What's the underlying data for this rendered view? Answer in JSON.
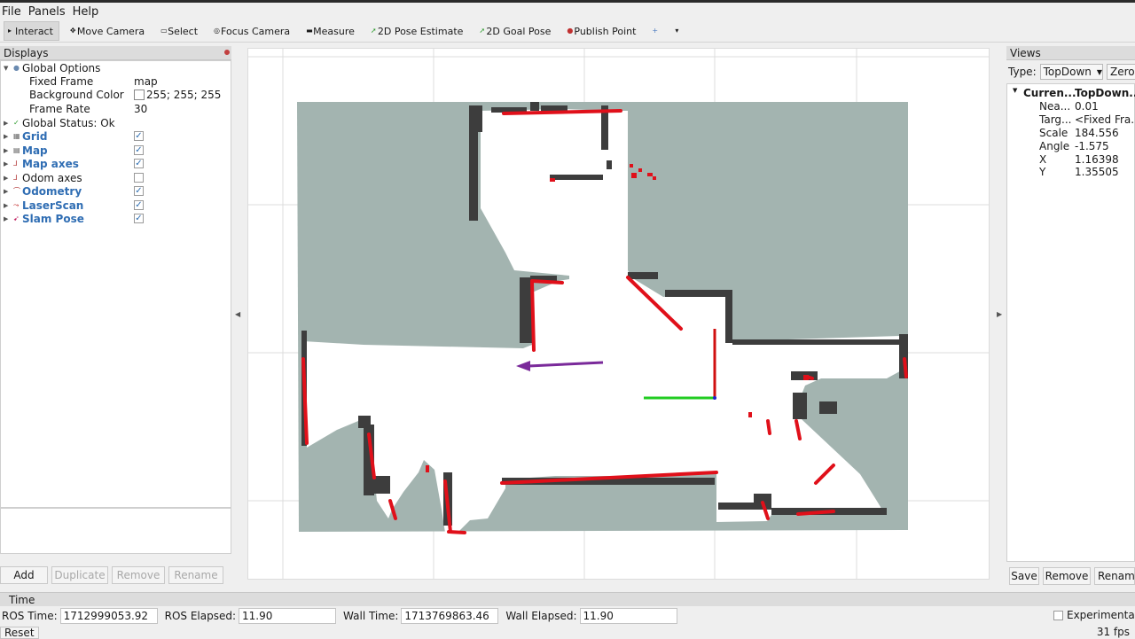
{
  "menu": [
    "File",
    "Panels",
    "Help"
  ],
  "toolbar": [
    {
      "label": "Interact",
      "icon": "cursor-icon",
      "active": true
    },
    {
      "label": "Move Camera",
      "icon": "move-icon"
    },
    {
      "label": "Select",
      "icon": "select-icon"
    },
    {
      "label": "Focus Camera",
      "icon": "focus-icon"
    },
    {
      "label": "Measure",
      "icon": "ruler-icon"
    },
    {
      "label": "2D Pose Estimate",
      "icon": "arrow-green-icon"
    },
    {
      "label": "2D Goal Pose",
      "icon": "arrow-green-icon"
    },
    {
      "label": "Publish Point",
      "icon": "pin-icon"
    }
  ],
  "displays": {
    "title": "Displays",
    "global_options": "Global Options",
    "fixed_frame_label": "Fixed Frame",
    "fixed_frame_value": "map",
    "background_label": "Background Color",
    "background_value": "255; 255; 255",
    "frame_rate_label": "Frame Rate",
    "frame_rate_value": "30",
    "global_status": "Global Status: Ok",
    "items": [
      {
        "name": "Grid",
        "checked": true,
        "bold": true
      },
      {
        "name": "Map",
        "checked": true,
        "bold": true
      },
      {
        "name": "Map axes",
        "checked": true,
        "bold": true
      },
      {
        "name": "Odom axes",
        "checked": false,
        "bold": false
      },
      {
        "name": "Odometry",
        "checked": true,
        "bold": true
      },
      {
        "name": "LaserScan",
        "checked": true,
        "bold": true
      },
      {
        "name": "Slam Pose",
        "checked": true,
        "bold": true
      }
    ],
    "buttons": {
      "add": "Add",
      "duplicate": "Duplicate",
      "remove": "Remove",
      "rename": "Rename"
    }
  },
  "views": {
    "title": "Views",
    "type_label": "Type:",
    "type_value": "TopDown",
    "zero_label": "Zero",
    "current_key": "Curren...",
    "current_val": "TopDown...",
    "props": [
      {
        "k": "Nea...",
        "v": "0.01"
      },
      {
        "k": "Targ...",
        "v": "<Fixed Fra..."
      },
      {
        "k": "Scale",
        "v": "184.556"
      },
      {
        "k": "Angle",
        "v": "-1.575"
      },
      {
        "k": "X",
        "v": "1.16398"
      },
      {
        "k": "Y",
        "v": "1.35505"
      }
    ],
    "buttons": {
      "save": "Save",
      "remove": "Remove",
      "rename": "Rename"
    }
  },
  "time": {
    "title": "Time",
    "ros_time_label": "ROS Time:",
    "ros_time": "1712999053.92",
    "ros_elapsed_label": "ROS Elapsed:",
    "ros_elapsed": "11.90",
    "wall_time_label": "Wall Time:",
    "wall_time": "1713769863.46",
    "wall_elapsed_label": "Wall Elapsed:",
    "wall_elapsed": "11.90",
    "experimental": "Experimental",
    "reset": "Reset",
    "fps": "31 fps"
  },
  "colors": {
    "unknown": "#a3b4b0",
    "free": "#ffffff",
    "occupied": "#3d3d3d",
    "laser": "#e0101a",
    "pose_arrow": "#7a2a9a",
    "axis_x": "#d01010",
    "axis_y": "#22cc22"
  }
}
